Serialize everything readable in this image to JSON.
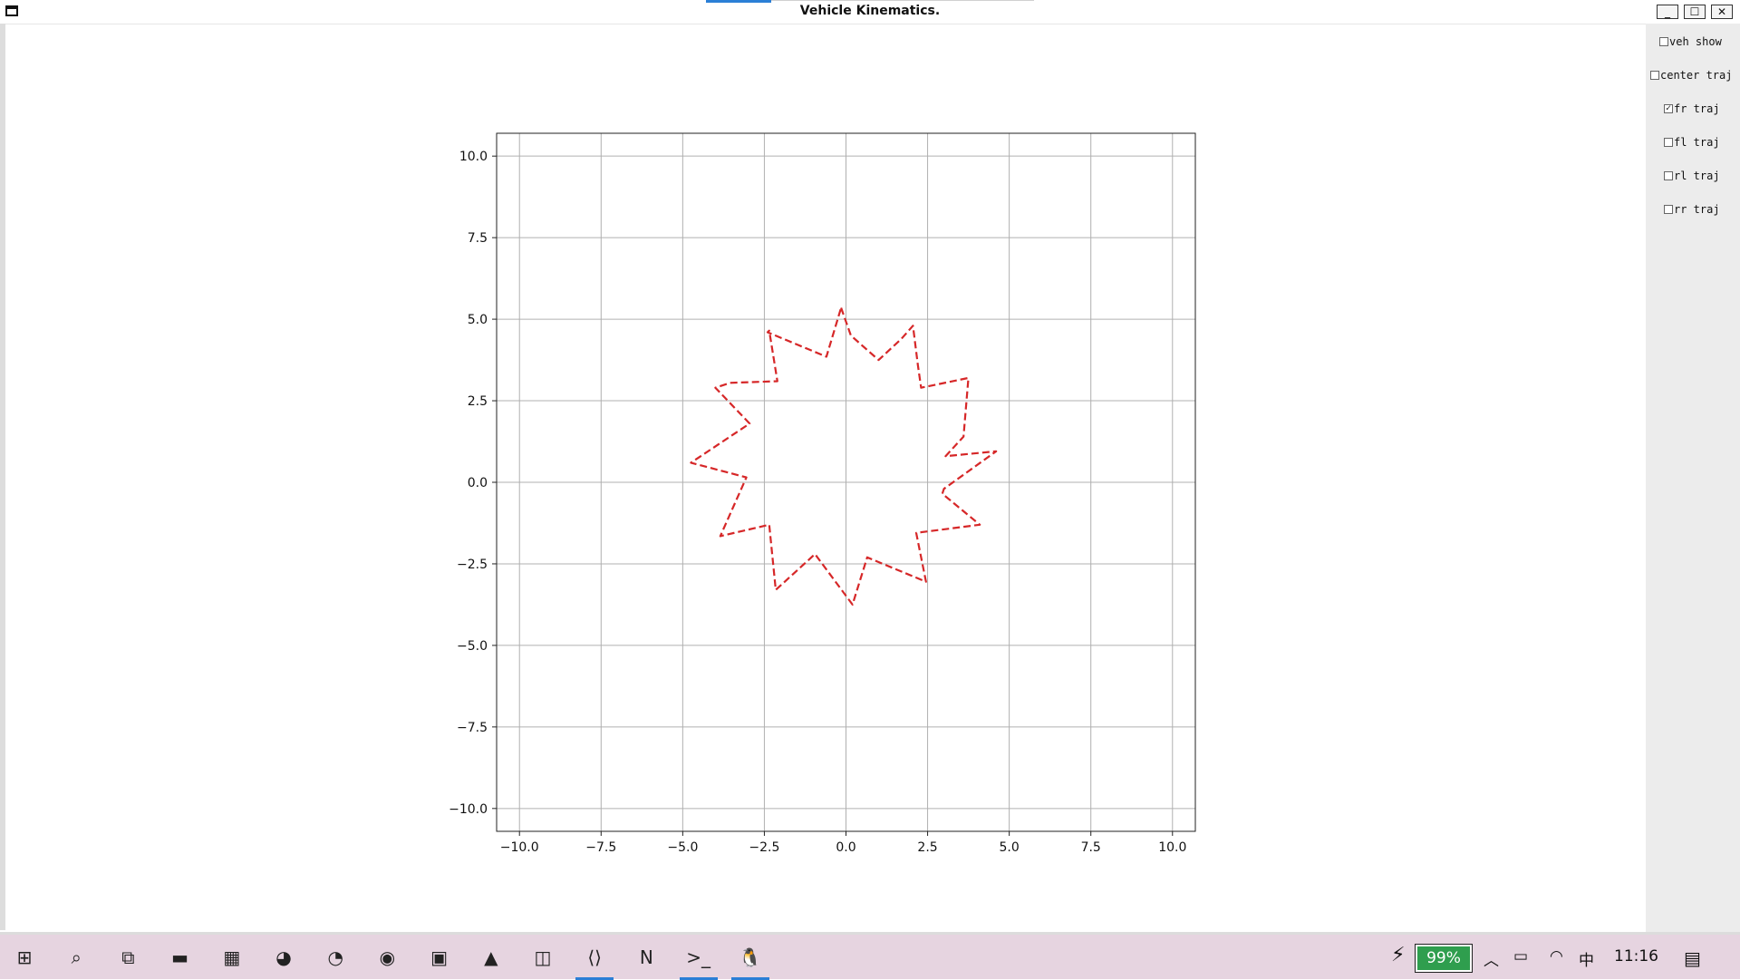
{
  "window": {
    "title": "Vehicle Kinematics.",
    "buttons": {
      "minimize": "_",
      "maximize": "☐",
      "close": "✕"
    }
  },
  "controls": [
    {
      "label": "veh show",
      "checked": false,
      "mark": ""
    },
    {
      "label": "center traj",
      "checked": false,
      "mark": ""
    },
    {
      "label": "fr traj",
      "checked": true,
      "mark": "✓"
    },
    {
      "label": "fl traj",
      "checked": false,
      "mark": ""
    },
    {
      "label": "rl traj",
      "checked": false,
      "mark": ""
    },
    {
      "label": "rr traj",
      "checked": false,
      "mark": ""
    }
  ],
  "chart_data": {
    "type": "line",
    "title": "",
    "xlabel": "",
    "ylabel": "",
    "xlim": [
      -10.7,
      10.7
    ],
    "ylim": [
      -10.7,
      10.7
    ],
    "x_ticks": [
      -10.0,
      -7.5,
      -5.0,
      -2.5,
      0.0,
      2.5,
      5.0,
      7.5,
      10.0
    ],
    "y_ticks": [
      -10.0,
      -7.5,
      -5.0,
      -2.5,
      0.0,
      2.5,
      5.0,
      7.5,
      10.0
    ],
    "x_tick_labels": [
      "−10.0",
      "−7.5",
      "−5.0",
      "−2.5",
      "0.0",
      "2.5",
      "5.0",
      "7.5",
      "10.0"
    ],
    "y_tick_labels": [
      "−10.0",
      "−7.5",
      "−5.0",
      "−2.5",
      "0.0",
      "2.5",
      "5.0",
      "7.5",
      "10.0"
    ],
    "grid": true,
    "series": [
      {
        "color": "#d62728",
        "style": "dashed",
        "x": [
          -0.15,
          0.15,
          1.0,
          1.7,
          2.05,
          2.2,
          2.3,
          3.75,
          3.6,
          3.05,
          4.6,
          3.0,
          2.95,
          4.1,
          2.15,
          2.45,
          0.65,
          0.2,
          -0.95,
          -2.15,
          -2.35,
          -3.85,
          -3.05,
          -4.75,
          -2.95,
          -4.0,
          -3.55,
          -2.1,
          -2.35,
          -2.4,
          -0.6,
          -0.15
        ],
        "y": [
          5.35,
          4.5,
          3.75,
          4.4,
          4.8,
          3.6,
          2.9,
          3.2,
          1.4,
          0.8,
          0.95,
          -0.2,
          -0.35,
          -1.3,
          -1.55,
          -3.05,
          -2.3,
          -3.75,
          -2.2,
          -3.3,
          -1.3,
          -1.65,
          0.15,
          0.6,
          1.8,
          2.9,
          3.05,
          3.1,
          4.65,
          4.6,
          3.85,
          5.35
        ]
      }
    ]
  },
  "taskbar": {
    "apps": [
      {
        "name": "windows-start-icon",
        "glyph": "⊞",
        "active": false
      },
      {
        "name": "search-icon",
        "glyph": "⌕",
        "active": false
      },
      {
        "name": "task-view-icon",
        "glyph": "⧉",
        "active": false
      },
      {
        "name": "file-explorer-icon",
        "glyph": "▬",
        "active": false
      },
      {
        "name": "calculator-icon",
        "glyph": "▦",
        "active": false
      },
      {
        "name": "edge-icon",
        "glyph": "◕",
        "active": false
      },
      {
        "name": "edge-dev-icon",
        "glyph": "◔",
        "active": false
      },
      {
        "name": "chrome-icon",
        "glyph": "◉",
        "active": false
      },
      {
        "name": "youdao-icon",
        "glyph": "▣",
        "active": false
      },
      {
        "name": "matlab-icon",
        "glyph": "▲",
        "active": false
      },
      {
        "name": "app-icon",
        "glyph": "◫",
        "active": false
      },
      {
        "name": "vscode-icon",
        "glyph": "⟨⟩",
        "active": true
      },
      {
        "name": "onenote-icon",
        "glyph": "N",
        "active": false
      },
      {
        "name": "terminal-icon",
        "glyph": ">_",
        "active": true
      },
      {
        "name": "linux-icon",
        "glyph": "🐧",
        "active": true
      }
    ],
    "battery": "99%",
    "ime": "中",
    "clock": "11:16"
  }
}
